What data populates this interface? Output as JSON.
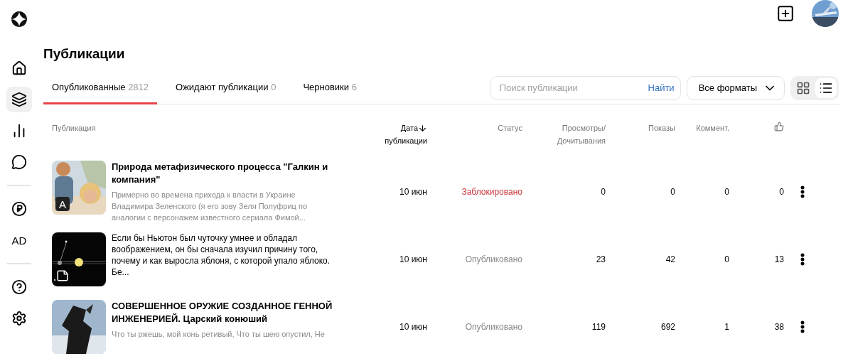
{
  "sidebar": {
    "groups": [
      [
        {
          "selected": false
        },
        {
          "selected": true
        },
        {
          "selected": false
        },
        {
          "selected": false
        }
      ],
      [
        {
          "selected": false
        },
        {
          "selected": false,
          "label": "AD"
        }
      ],
      [
        {
          "selected": false
        },
        {
          "selected": false
        }
      ]
    ]
  },
  "title": "Публикации",
  "tabs": [
    {
      "label": "Опубликованные",
      "count": "2812",
      "selected": true
    },
    {
      "label": "Ожидают публикации",
      "count": "0",
      "selected": false
    },
    {
      "label": "Черновики",
      "count": "6",
      "selected": false
    }
  ],
  "search": {
    "placeholder": "Поиск публикации",
    "button": "Найти"
  },
  "format_select": {
    "value": "Все форматы"
  },
  "view_toggle": [
    {
      "selected": false
    },
    {
      "selected": true
    }
  ],
  "table": {
    "columns": [
      {
        "lines": [
          "Публикация"
        ]
      },
      {
        "lines": [
          "Дата",
          "публикации"
        ],
        "sorted": true
      },
      {
        "lines": [
          "Статус"
        ]
      },
      {
        "lines": [
          "Просмотры/",
          "Дочитывания"
        ]
      },
      {
        "lines": [
          "Показы"
        ]
      },
      {
        "lines": [
          "Коммент."
        ]
      },
      {
        "kind": "likes"
      }
    ],
    "rows": [
      {
        "kind": "article",
        "badge": {
          "kind": "letter",
          "text": "A"
        },
        "title": "Природа метафизического процесса \"Галкин и компания\"",
        "snippet": "Примерно во времена прихода к власти в Украине Владимира Зеленского (я его зову Зеля Полуфриц по аналогии с персонажем известного сериала Фимой...",
        "date": "10 июн",
        "status": {
          "text": "Заблокировано",
          "kind": "blocked"
        },
        "views": "0",
        "shows": "0",
        "comments": "0",
        "likes": "0"
      },
      {
        "kind": "post",
        "badge": {
          "kind": "note"
        },
        "title": "Если бы Ньютон был чуточку умнее и обладал воображением, он бы сначала изучил причину того, почему и как выросла яблоня, с которой упало яблоко. Бе...",
        "date": "10 июн",
        "status": {
          "text": "Опубликовано",
          "kind": "published"
        },
        "views": "23",
        "shows": "42",
        "comments": "0",
        "likes": "13"
      },
      {
        "kind": "article",
        "title": "СОВЕРШЕННОЕ ОРУЖИЕ СОЗДАННОЕ ГЕННОЙ ИНЖЕНЕРИЕЙ. Царский конюший",
        "snippet": "Что ты ржешь, мой конь ретивый, Что ты шею опустил, Не",
        "date": "10 июн",
        "status": {
          "text": "Опубликовано",
          "kind": "published"
        },
        "views": "119",
        "shows": "692",
        "comments": "1",
        "likes": "38"
      }
    ]
  }
}
